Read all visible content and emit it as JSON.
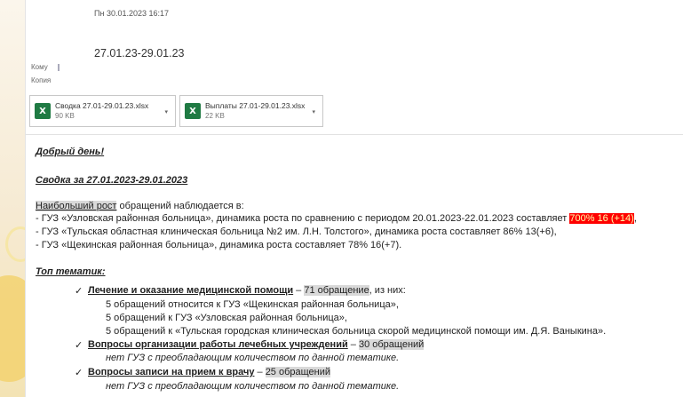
{
  "header": {
    "date": "Пн 30.01.2023 16:17",
    "subject": "27.01.23-29.01.23",
    "to_label": "Кому",
    "cc_label": "Копия"
  },
  "attachments": [
    {
      "name": "Сводка 27.01-29.01.23.xlsx",
      "size": "90 KB",
      "icon": "excel-icon"
    },
    {
      "name": "Выплаты 27.01-29.01.23.xlsx",
      "size": "22 KB",
      "icon": "excel-icon"
    }
  ],
  "body": {
    "greeting": "Добрый день!",
    "summary_title": "Сводка за 27.01.2023-29.01.2023",
    "intro_highlight": "Наибольший рост",
    "intro_rest": " обращений наблюдается в:",
    "line1_text": "- ГУЗ «Узловская районная больница», динамика роста по сравнению с периодом 20.01.2023-22.01.2023 составляет ",
    "line1_red": "700% 16 (+14)",
    "line1_end": ",",
    "line2": "- ГУЗ «Тульская областная клиническая больница №2 им. Л.Н. Толстого», динамика роста составляет 86% 13(+6),",
    "line3": "- ГУЗ «Щекинская районная больница», динамика роста составляет 78% 16(+7).",
    "topics_title": "Топ тематик:",
    "topics": [
      {
        "title": "Лечение и оказание медицинской помощи",
        "dash": " – ",
        "count": "71 обращение",
        "suffix": ", из них:",
        "details": [
          "5 обращений относится к ГУЗ «Щекинская районная больница»,",
          "5 обращений к ГУЗ «Узловская районная больница»,",
          "5 обращений к «Тульская городская клиническая больница скорой медицинской помощи им. Д.Я. Ваныкина»."
        ]
      },
      {
        "title": "Вопросы организации работы лечебных учреждений",
        "dash": " – ",
        "count": "30 обращений",
        "note": "нет ГУЗ с преобладающим количеством по данной тематике."
      },
      {
        "title": "Вопросы записи на прием к врачу",
        "dash": " – ",
        "count": "25 обращений",
        "note": "нет ГУЗ с преобладающим количеством по данной тематике."
      }
    ]
  }
}
